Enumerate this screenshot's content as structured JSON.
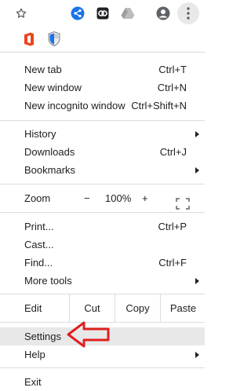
{
  "toolbar": {
    "bookmark_icon": "star-outline-icon",
    "extensions": [
      "share-extension-icon",
      "link-extension-icon",
      "drive-extension-icon"
    ],
    "profile_icon": "account-circle-icon",
    "menu_icon": "vertical-dots-icon"
  },
  "pinned_extensions": [
    "office-extension-icon",
    "shield-extension-icon"
  ],
  "menu": {
    "new_tab": {
      "label": "New tab",
      "shortcut": "Ctrl+T"
    },
    "new_window": {
      "label": "New window",
      "shortcut": "Ctrl+N"
    },
    "new_incognito": {
      "label": "New incognito window",
      "shortcut": "Ctrl+Shift+N"
    },
    "history": {
      "label": "History"
    },
    "downloads": {
      "label": "Downloads",
      "shortcut": "Ctrl+J"
    },
    "bookmarks": {
      "label": "Bookmarks"
    },
    "zoom": {
      "label": "Zoom",
      "minus": "−",
      "value": "100%",
      "plus": "+"
    },
    "print": {
      "label": "Print...",
      "shortcut": "Ctrl+P"
    },
    "cast": {
      "label": "Cast..."
    },
    "find": {
      "label": "Find...",
      "shortcut": "Ctrl+F"
    },
    "more_tools": {
      "label": "More tools"
    },
    "edit": {
      "label": "Edit",
      "cut": "Cut",
      "copy": "Copy",
      "paste": "Paste"
    },
    "settings": {
      "label": "Settings"
    },
    "help": {
      "label": "Help"
    },
    "exit": {
      "label": "Exit"
    }
  },
  "colors": {
    "highlight": "#e8e8e9",
    "separator": "#dadce0",
    "callout": "#e02020",
    "share_blue": "#1a73e8"
  }
}
